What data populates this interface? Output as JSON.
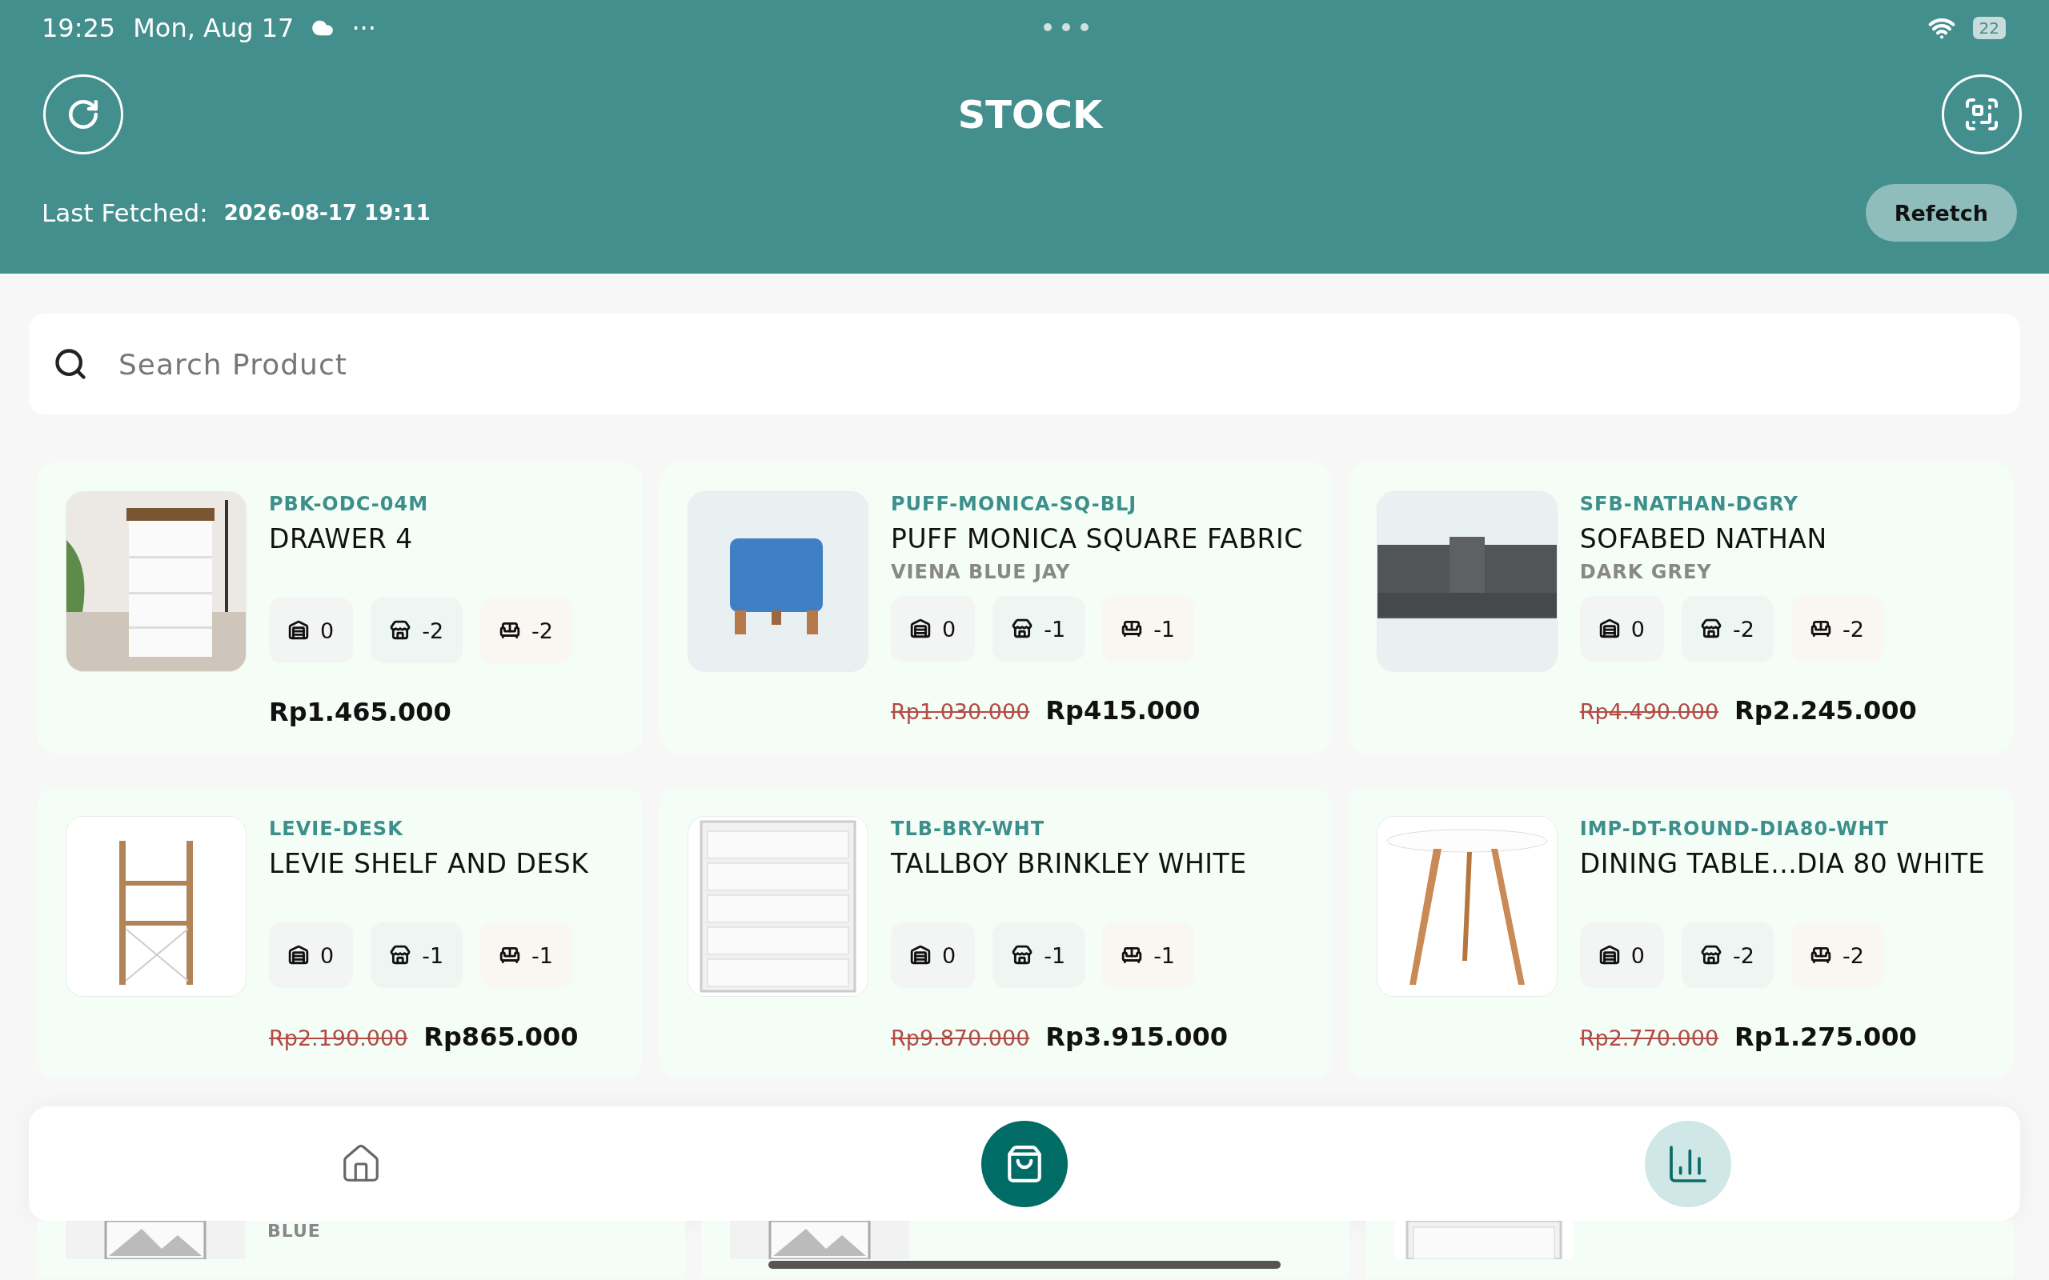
{
  "status_bar": {
    "time": "19:25",
    "date": "Mon, Aug 17",
    "more": "···",
    "battery": "22"
  },
  "header": {
    "title": "STOCK",
    "last_fetched_label": "Last Fetched:",
    "last_fetched_value": "2026-08-17 19:11",
    "refetch_button": "Refetch"
  },
  "search": {
    "placeholder": "Search Product"
  },
  "products": [
    {
      "image": {
        "kind": "picture"
      },
      "sku": "PBK-ODC-04M",
      "name": "DRAWER 4",
      "stock": [
        {
          "kind": "warehouse",
          "value": "0"
        },
        {
          "kind": "store",
          "value": "-2"
        },
        {
          "kind": "showroom",
          "value": "-2"
        }
      ],
      "price": "Rp1.465.000"
    },
    {
      "image": {
        "kind": "picture"
      },
      "sku": "PUFF-MONICA-SQ-BLJ",
      "name": "PUFF MONICA SQUARE FABRIC",
      "variant": "VIENA BLUE JAY",
      "stock": [
        {
          "kind": "warehouse",
          "value": "0"
        },
        {
          "kind": "store",
          "value": "-1"
        },
        {
          "kind": "showroom",
          "value": "-1"
        }
      ],
      "old_price": "Rp1.030.000",
      "price": "Rp415.000"
    },
    {
      "image": {
        "kind": "picture"
      },
      "sku": "SFB-NATHAN-DGRY",
      "name": "SOFABED NATHAN",
      "variant": "DARK GREY",
      "stock": [
        {
          "kind": "warehouse",
          "value": "0"
        },
        {
          "kind": "store",
          "value": "-2"
        },
        {
          "kind": "showroom",
          "value": "-2"
        }
      ],
      "old_price": "Rp4.490.000",
      "price": "Rp2.245.000"
    },
    {
      "image": {
        "kind": "picture"
      },
      "sku": "LEVIE-DESK",
      "name": "LEVIE SHELF AND DESK",
      "stock": [
        {
          "kind": "warehouse",
          "value": "0"
        },
        {
          "kind": "store",
          "value": "-1"
        },
        {
          "kind": "showroom",
          "value": "-1"
        }
      ],
      "old_price": "Rp2.190.000",
      "price": "Rp865.000"
    },
    {
      "image": {
        "kind": "picture"
      },
      "sku": "TLB-BRY-WHT",
      "name": "TALLBOY BRINKLEY WHITE",
      "stock": [
        {
          "kind": "warehouse",
          "value": "0"
        },
        {
          "kind": "store",
          "value": "-1"
        },
        {
          "kind": "showroom",
          "value": "-1"
        }
      ],
      "old_price": "Rp9.870.000",
      "price": "Rp3.915.000"
    },
    {
      "image": {
        "kind": "picture"
      },
      "sku": "IMP-DT-ROUND-DIA80-WHT",
      "name": "DINING TABLE...DIA 80 WHITE",
      "stock": [
        {
          "kind": "warehouse",
          "value": "0"
        },
        {
          "kind": "store",
          "value": "-2"
        },
        {
          "kind": "showroom",
          "value": "-2"
        }
      ],
      "old_price": "Rp2.770.000",
      "price": "Rp1.275.000"
    },
    {
      "image": {
        "kind": "picture"
      },
      "variant": "BLUE"
    },
    {
      "image": {
        "kind": "picture"
      }
    },
    {
      "image": {
        "kind": "picture"
      }
    }
  ],
  "nav": [
    {
      "kind": "home",
      "selected": false,
      "highlighted": false
    },
    {
      "kind": "bag",
      "selected": true,
      "highlighted": false
    },
    {
      "kind": "chart",
      "selected": false,
      "highlighted": true
    }
  ]
}
